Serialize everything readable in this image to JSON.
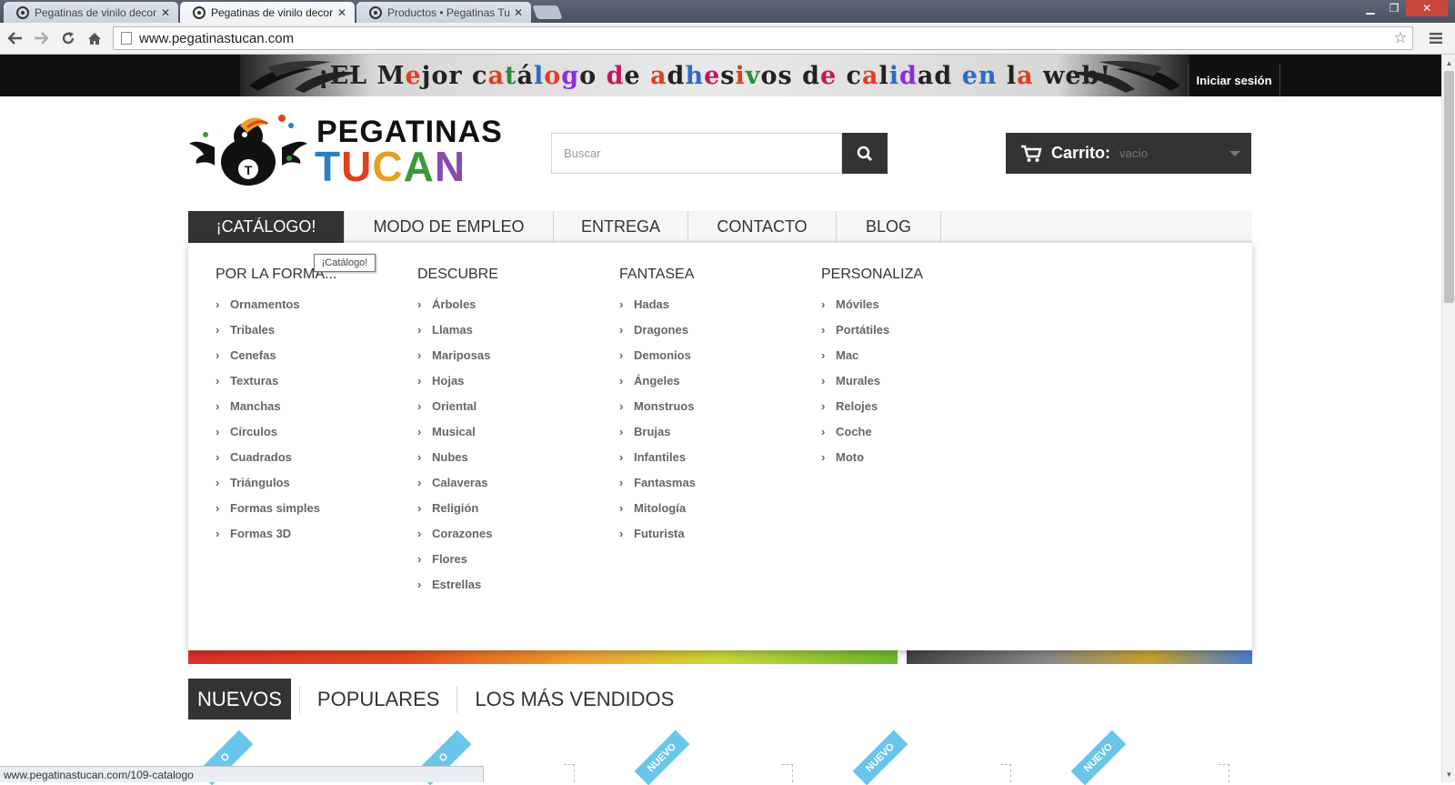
{
  "browser": {
    "tabs": [
      {
        "title": "Pegatinas de vinilo decora",
        "close": "✕"
      },
      {
        "title": "Pegatinas de vinilo decora",
        "close": "✕"
      },
      {
        "title": "Productos • Pegatinas Tuc",
        "close": "✕"
      }
    ],
    "url": "www.pegatinastucan.com",
    "status_url": "www.pegatinastucan.com/109-catalogo"
  },
  "banner": {
    "slogan_parts": [
      {
        "text": "¡",
        "color": "#222222"
      },
      {
        "text": "E",
        "color": "#222222"
      },
      {
        "text": "L ",
        "color": "#222222"
      },
      {
        "text": "M",
        "color": "#222222"
      },
      {
        "text": "e",
        "color": "#e0401f"
      },
      {
        "text": "jor ",
        "color": "#222222"
      },
      {
        "text": "c",
        "color": "#222222"
      },
      {
        "text": "a",
        "color": "#e0401f"
      },
      {
        "text": "t",
        "color": "#2e8b3a"
      },
      {
        "text": "á",
        "color": "#222222"
      },
      {
        "text": "l",
        "color": "#2b6cc4"
      },
      {
        "text": "o",
        "color": "#e0401f"
      },
      {
        "text": "g",
        "color": "#8a2be2"
      },
      {
        "text": "o ",
        "color": "#222222"
      },
      {
        "text": "d",
        "color": "#c2185b"
      },
      {
        "text": "e ",
        "color": "#222222"
      },
      {
        "text": "a",
        "color": "#e0401f"
      },
      {
        "text": "d",
        "color": "#222222"
      },
      {
        "text": "h",
        "color": "#2b6cc4"
      },
      {
        "text": "e",
        "color": "#c2185b"
      },
      {
        "text": "s",
        "color": "#222222"
      },
      {
        "text": "i",
        "color": "#e0401f"
      },
      {
        "text": "v",
        "color": "#2e8b3a"
      },
      {
        "text": "o",
        "color": "#222222"
      },
      {
        "text": "s ",
        "color": "#222222"
      },
      {
        "text": "d",
        "color": "#222222"
      },
      {
        "text": "e ",
        "color": "#c2185b"
      },
      {
        "text": "c",
        "color": "#222222"
      },
      {
        "text": "a",
        "color": "#e0401f"
      },
      {
        "text": "l",
        "color": "#222222"
      },
      {
        "text": "i",
        "color": "#2b6cc4"
      },
      {
        "text": "d",
        "color": "#8a2be2"
      },
      {
        "text": "a",
        "color": "#222222"
      },
      {
        "text": "d ",
        "color": "#222222"
      },
      {
        "text": "e",
        "color": "#2b6cc4"
      },
      {
        "text": "n ",
        "color": "#2b6cc4"
      },
      {
        "text": "l",
        "color": "#222222"
      },
      {
        "text": "a ",
        "color": "#e0401f"
      },
      {
        "text": "w",
        "color": "#222222"
      },
      {
        "text": "e",
        "color": "#222222"
      },
      {
        "text": "b",
        "color": "#222222"
      },
      {
        "text": "!",
        "color": "#222222"
      }
    ],
    "login": "Iniciar sesión"
  },
  "header": {
    "logo_line1": "PEGATINAS",
    "logo_line2_letters": [
      {
        "text": "T",
        "color": "#2b7fc4"
      },
      {
        "text": "U",
        "color": "#e0401f"
      },
      {
        "text": "C",
        "color": "#e8a020"
      },
      {
        "text": "A",
        "color": "#3a9a3a"
      },
      {
        "text": "N",
        "color": "#8a4bb0"
      }
    ],
    "search_placeholder": "Buscar",
    "cart_label": "Carrito:",
    "cart_value": "vacío"
  },
  "menu": {
    "items": [
      "¡Catálogo!",
      "Modo de empleo",
      "Entrega",
      "Contacto",
      "Blog"
    ],
    "tooltip": "¡Catálogo!"
  },
  "dropdown": {
    "columns": [
      {
        "title": "Por la forma...",
        "items": [
          "Ornamentos",
          "Tribales",
          "Cenefas",
          "Texturas",
          "Manchas",
          "Círculos",
          "Cuadrados",
          "Triángulos",
          "Formas simples",
          "Formas 3D"
        ]
      },
      {
        "title": "Descubre",
        "items": [
          "Árboles",
          "Llamas",
          "Mariposas",
          "Hojas",
          "Oriental",
          "Musical",
          "Nubes",
          "Calaveras",
          "Religión",
          "Corazones",
          "Flores",
          "Estrellas"
        ]
      },
      {
        "title": "Fantasea",
        "items": [
          "Hadas",
          "Dragones",
          "Demonios",
          "Ángeles",
          "Monstruos",
          "Brujas",
          "Infantiles",
          "Fantasmas",
          "Mitología",
          "Futurista"
        ]
      },
      {
        "title": "Personaliza",
        "items": [
          "Móviles",
          "Portátiles",
          "Mac",
          "Murales",
          "Relojes",
          "Coche",
          "Moto"
        ]
      }
    ]
  },
  "product_tabs": [
    "Nuevos",
    "Populares",
    "Los más vendidos"
  ],
  "ribbons": [
    "O",
    "O",
    "NUEVO",
    "NUEVO",
    "NUEVO"
  ]
}
